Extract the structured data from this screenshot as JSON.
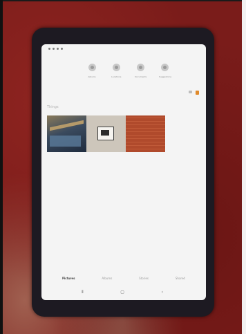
{
  "categories": [
    {
      "label": "Albums",
      "icon": "people-icon"
    },
    {
      "label": "Locations",
      "icon": "location-icon"
    },
    {
      "label": "Documents",
      "icon": "document-icon"
    },
    {
      "label": "Suggestions",
      "icon": "suggestion-icon"
    }
  ],
  "section_title": "Things",
  "tabs": [
    {
      "label": "Pictures",
      "active": true
    },
    {
      "label": "Albums",
      "active": false
    },
    {
      "label": "Stories",
      "active": false
    },
    {
      "label": "Shared",
      "active": false
    }
  ],
  "nav": {
    "recent": "⦀",
    "home": "▢",
    "back": "‹"
  },
  "colors": {
    "carpet": "#7a1c1a",
    "tablet_bezel": "#1d1a22",
    "screen": "#f4f4f4",
    "accent": "#e08a2c"
  }
}
